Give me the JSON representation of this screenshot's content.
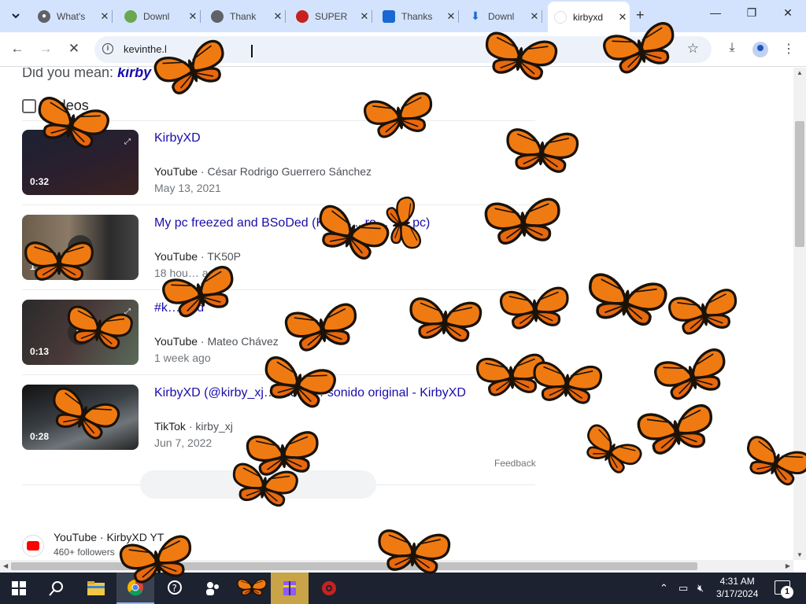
{
  "colors": {
    "accent": "#1a0dab",
    "butterfly": "#f07a12",
    "tabstrip": "#d3e3fd",
    "taskbar": "#1c2230"
  },
  "browser": {
    "tabs": [
      {
        "title": "What's",
        "icon": "chrome-icon"
      },
      {
        "title": "Downl",
        "icon": "download-site-icon"
      },
      {
        "title": "Thank",
        "icon": "globe-icon"
      },
      {
        "title": "SUPER",
        "icon": "superantispyware-icon"
      },
      {
        "title": "Thanks",
        "icon": "download-site-icon"
      },
      {
        "title": "Downl",
        "icon": "download-icon"
      },
      {
        "title": "kirbyxd",
        "icon": "google-icon",
        "active": true
      }
    ],
    "url": "kevinthe.l"
  },
  "page": {
    "did_you_mean_prefix": "Did you mean: ",
    "did_you_mean_term": "kirby",
    "videos_heading": "Videos",
    "videos": [
      {
        "title": "KirbyXD",
        "host": "YouTube",
        "author": "César Rodrigo Guerrero Sánchez",
        "date": "May 13, 2021",
        "duration": "0:32"
      },
      {
        "title": "My pc freezed and BSoDed (Kirb… ...ro… ...y pc)",
        "host": "YouTube",
        "author": "TK50P",
        "date": "18 hou… ago",
        "duration": "1:38"
      },
      {
        "title": "#k… #xd",
        "host": "YouTube",
        "author": "Mateo Chávez",
        "date": "1 week ago",
        "duration": "0:13"
      },
      {
        "title": "KirbyXD (@kirby_xj… ...deo… sonido original - KirbyXD",
        "host": "TikTok",
        "author": "kirby_xj",
        "date": "Jun 7, 2022",
        "duration": "0:28"
      }
    ],
    "feedback": "Feedback",
    "more_arrow": "→",
    "yt_result": {
      "source": "YouTube · KirbyXD YT",
      "followers": "460+ followers"
    }
  },
  "taskbar": {
    "time": "4:31 AM",
    "date": "3/17/2024",
    "notification_count": "1"
  }
}
